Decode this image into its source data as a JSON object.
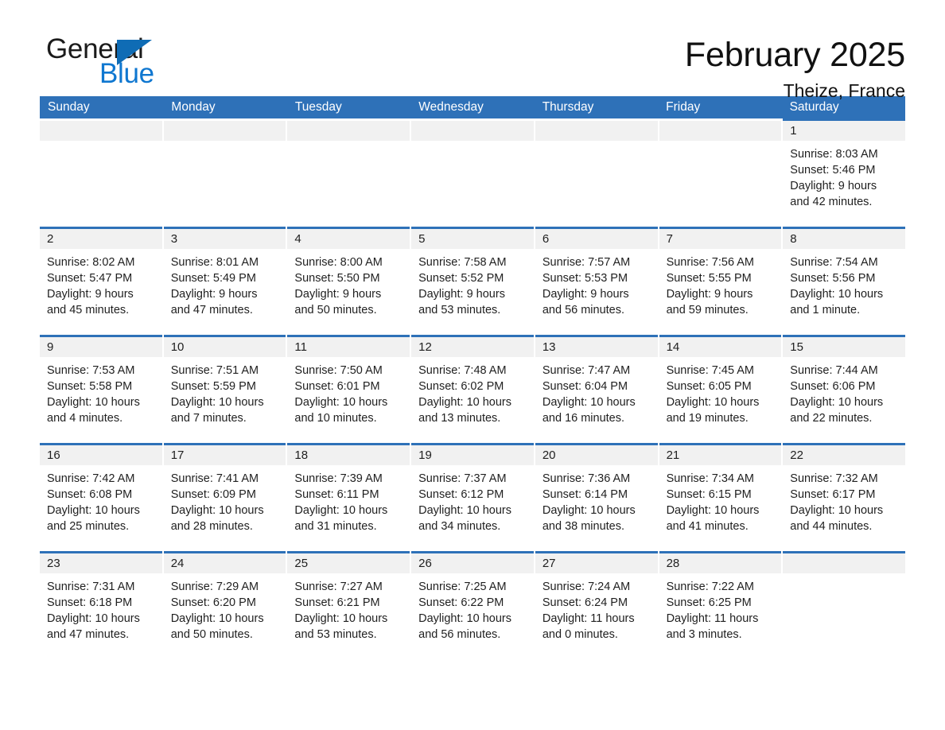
{
  "brand": {
    "name_part1": "General",
    "name_part2": "Blue",
    "accent_color": "#0f6cb5",
    "blue_text_color": "#0f77d0"
  },
  "header": {
    "month_title": "February 2025",
    "location": "Theize, France"
  },
  "calendar": {
    "header_color": "#2e71b8",
    "day_band_color": "#f1f1f1",
    "weekdays": [
      "Sunday",
      "Monday",
      "Tuesday",
      "Wednesday",
      "Thursday",
      "Friday",
      "Saturday"
    ],
    "weeks": [
      [
        {
          "day": "",
          "empty": true
        },
        {
          "day": "",
          "empty": true
        },
        {
          "day": "",
          "empty": true
        },
        {
          "day": "",
          "empty": true
        },
        {
          "day": "",
          "empty": true
        },
        {
          "day": "",
          "empty": true
        },
        {
          "day": "1",
          "sunrise": "Sunrise: 8:03 AM",
          "sunset": "Sunset: 5:46 PM",
          "daylight_line1": "Daylight: 9 hours",
          "daylight_line2": "and 42 minutes."
        }
      ],
      [
        {
          "day": "2",
          "sunrise": "Sunrise: 8:02 AM",
          "sunset": "Sunset: 5:47 PM",
          "daylight_line1": "Daylight: 9 hours",
          "daylight_line2": "and 45 minutes."
        },
        {
          "day": "3",
          "sunrise": "Sunrise: 8:01 AM",
          "sunset": "Sunset: 5:49 PM",
          "daylight_line1": "Daylight: 9 hours",
          "daylight_line2": "and 47 minutes."
        },
        {
          "day": "4",
          "sunrise": "Sunrise: 8:00 AM",
          "sunset": "Sunset: 5:50 PM",
          "daylight_line1": "Daylight: 9 hours",
          "daylight_line2": "and 50 minutes."
        },
        {
          "day": "5",
          "sunrise": "Sunrise: 7:58 AM",
          "sunset": "Sunset: 5:52 PM",
          "daylight_line1": "Daylight: 9 hours",
          "daylight_line2": "and 53 minutes."
        },
        {
          "day": "6",
          "sunrise": "Sunrise: 7:57 AM",
          "sunset": "Sunset: 5:53 PM",
          "daylight_line1": "Daylight: 9 hours",
          "daylight_line2": "and 56 minutes."
        },
        {
          "day": "7",
          "sunrise": "Sunrise: 7:56 AM",
          "sunset": "Sunset: 5:55 PM",
          "daylight_line1": "Daylight: 9 hours",
          "daylight_line2": "and 59 minutes."
        },
        {
          "day": "8",
          "sunrise": "Sunrise: 7:54 AM",
          "sunset": "Sunset: 5:56 PM",
          "daylight_line1": "Daylight: 10 hours",
          "daylight_line2": "and 1 minute."
        }
      ],
      [
        {
          "day": "9",
          "sunrise": "Sunrise: 7:53 AM",
          "sunset": "Sunset: 5:58 PM",
          "daylight_line1": "Daylight: 10 hours",
          "daylight_line2": "and 4 minutes."
        },
        {
          "day": "10",
          "sunrise": "Sunrise: 7:51 AM",
          "sunset": "Sunset: 5:59 PM",
          "daylight_line1": "Daylight: 10 hours",
          "daylight_line2": "and 7 minutes."
        },
        {
          "day": "11",
          "sunrise": "Sunrise: 7:50 AM",
          "sunset": "Sunset: 6:01 PM",
          "daylight_line1": "Daylight: 10 hours",
          "daylight_line2": "and 10 minutes."
        },
        {
          "day": "12",
          "sunrise": "Sunrise: 7:48 AM",
          "sunset": "Sunset: 6:02 PM",
          "daylight_line1": "Daylight: 10 hours",
          "daylight_line2": "and 13 minutes."
        },
        {
          "day": "13",
          "sunrise": "Sunrise: 7:47 AM",
          "sunset": "Sunset: 6:04 PM",
          "daylight_line1": "Daylight: 10 hours",
          "daylight_line2": "and 16 minutes."
        },
        {
          "day": "14",
          "sunrise": "Sunrise: 7:45 AM",
          "sunset": "Sunset: 6:05 PM",
          "daylight_line1": "Daylight: 10 hours",
          "daylight_line2": "and 19 minutes."
        },
        {
          "day": "15",
          "sunrise": "Sunrise: 7:44 AM",
          "sunset": "Sunset: 6:06 PM",
          "daylight_line1": "Daylight: 10 hours",
          "daylight_line2": "and 22 minutes."
        }
      ],
      [
        {
          "day": "16",
          "sunrise": "Sunrise: 7:42 AM",
          "sunset": "Sunset: 6:08 PM",
          "daylight_line1": "Daylight: 10 hours",
          "daylight_line2": "and 25 minutes."
        },
        {
          "day": "17",
          "sunrise": "Sunrise: 7:41 AM",
          "sunset": "Sunset: 6:09 PM",
          "daylight_line1": "Daylight: 10 hours",
          "daylight_line2": "and 28 minutes."
        },
        {
          "day": "18",
          "sunrise": "Sunrise: 7:39 AM",
          "sunset": "Sunset: 6:11 PM",
          "daylight_line1": "Daylight: 10 hours",
          "daylight_line2": "and 31 minutes."
        },
        {
          "day": "19",
          "sunrise": "Sunrise: 7:37 AM",
          "sunset": "Sunset: 6:12 PM",
          "daylight_line1": "Daylight: 10 hours",
          "daylight_line2": "and 34 minutes."
        },
        {
          "day": "20",
          "sunrise": "Sunrise: 7:36 AM",
          "sunset": "Sunset: 6:14 PM",
          "daylight_line1": "Daylight: 10 hours",
          "daylight_line2": "and 38 minutes."
        },
        {
          "day": "21",
          "sunrise": "Sunrise: 7:34 AM",
          "sunset": "Sunset: 6:15 PM",
          "daylight_line1": "Daylight: 10 hours",
          "daylight_line2": "and 41 minutes."
        },
        {
          "day": "22",
          "sunrise": "Sunrise: 7:32 AM",
          "sunset": "Sunset: 6:17 PM",
          "daylight_line1": "Daylight: 10 hours",
          "daylight_line2": "and 44 minutes."
        }
      ],
      [
        {
          "day": "23",
          "sunrise": "Sunrise: 7:31 AM",
          "sunset": "Sunset: 6:18 PM",
          "daylight_line1": "Daylight: 10 hours",
          "daylight_line2": "and 47 minutes."
        },
        {
          "day": "24",
          "sunrise": "Sunrise: 7:29 AM",
          "sunset": "Sunset: 6:20 PM",
          "daylight_line1": "Daylight: 10 hours",
          "daylight_line2": "and 50 minutes."
        },
        {
          "day": "25",
          "sunrise": "Sunrise: 7:27 AM",
          "sunset": "Sunset: 6:21 PM",
          "daylight_line1": "Daylight: 10 hours",
          "daylight_line2": "and 53 minutes."
        },
        {
          "day": "26",
          "sunrise": "Sunrise: 7:25 AM",
          "sunset": "Sunset: 6:22 PM",
          "daylight_line1": "Daylight: 10 hours",
          "daylight_line2": "and 56 minutes."
        },
        {
          "day": "27",
          "sunrise": "Sunrise: 7:24 AM",
          "sunset": "Sunset: 6:24 PM",
          "daylight_line1": "Daylight: 11 hours",
          "daylight_line2": "and 0 minutes."
        },
        {
          "day": "28",
          "sunrise": "Sunrise: 7:22 AM",
          "sunset": "Sunset: 6:25 PM",
          "daylight_line1": "Daylight: 11 hours",
          "daylight_line2": "and 3 minutes."
        },
        {
          "day": "",
          "blank": true
        }
      ]
    ]
  }
}
